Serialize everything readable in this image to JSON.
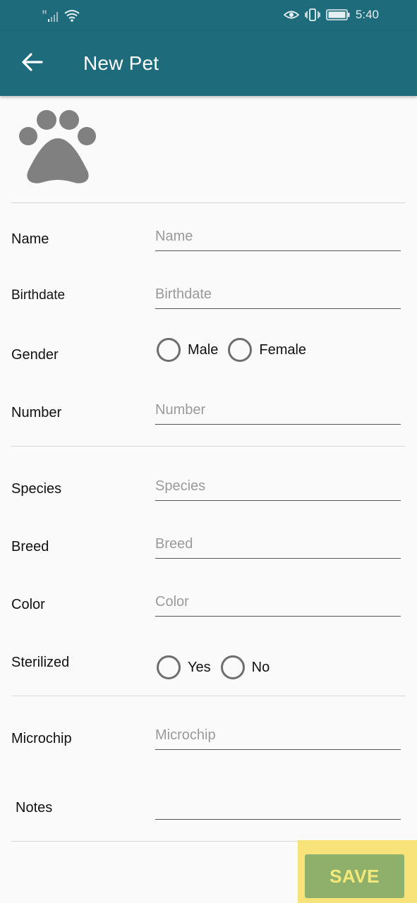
{
  "status_bar": {
    "signal_icon": "signal-icon",
    "wifi_icon": "wifi-icon",
    "eye_icon": "eye-icon",
    "vibrate_icon": "vibrate-icon",
    "battery_icon": "battery-icon",
    "time": "5:40"
  },
  "app_bar": {
    "back_icon": "arrow-back-icon",
    "title": "New Pet",
    "background": "#1e6b7b"
  },
  "avatar": {
    "icon": "paw-icon",
    "color": "#808080"
  },
  "form": {
    "name": {
      "label": "Name",
      "placeholder": "Name",
      "value": ""
    },
    "birthdate": {
      "label": "Birthdate",
      "placeholder": "Birthdate",
      "value": ""
    },
    "gender": {
      "label": "Gender",
      "options": [
        "Male",
        "Female"
      ],
      "selected": null
    },
    "number": {
      "label": "Number",
      "placeholder": "Number",
      "value": ""
    },
    "species": {
      "label": "Species",
      "placeholder": "Species",
      "value": ""
    },
    "breed": {
      "label": "Breed",
      "placeholder": "Breed",
      "value": ""
    },
    "color": {
      "label": "Color",
      "placeholder": "Color",
      "value": ""
    },
    "sterilized": {
      "label": "Sterilized",
      "options": [
        "Yes",
        "No"
      ],
      "selected": null
    },
    "microchip": {
      "label": "Microchip",
      "placeholder": "Microchip",
      "value": ""
    },
    "notes": {
      "label": "Notes",
      "placeholder": "",
      "value": ""
    }
  },
  "save_button": {
    "label": "SAVE",
    "background": "#8fb06a",
    "text_color": "#f4e97a",
    "highlight": "#f8e27a"
  }
}
